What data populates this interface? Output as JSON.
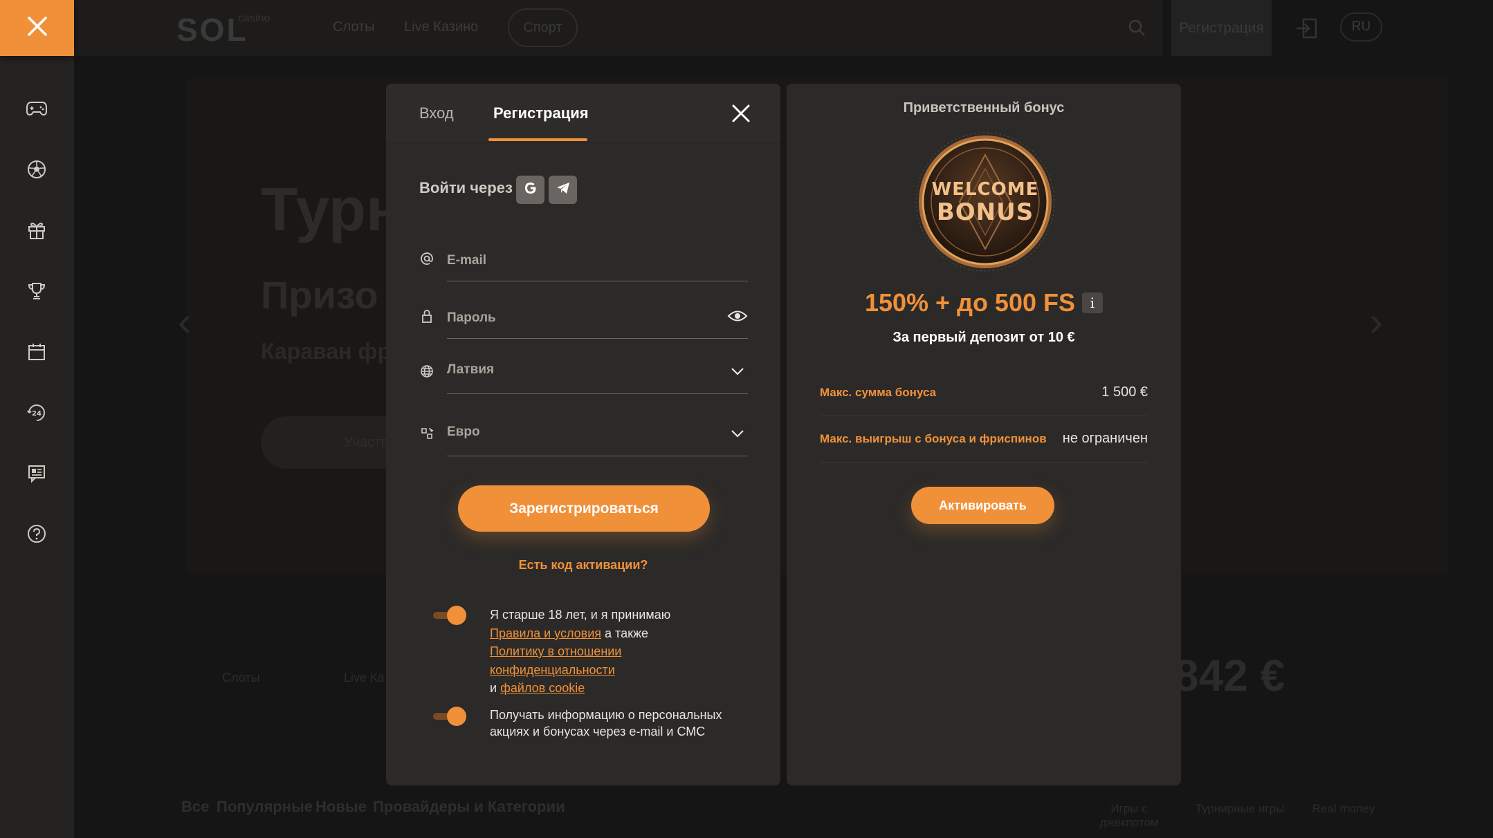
{
  "colors": {
    "accent": "#f0913a",
    "panel": "#2c2a28",
    "sidebar": "#252321"
  },
  "sidebar": {
    "items": [
      {
        "icon": "gamepad-icon"
      },
      {
        "icon": "soccer-ball-icon"
      },
      {
        "icon": "gift-icon"
      },
      {
        "icon": "trophy-icon"
      },
      {
        "icon": "calendar-icon"
      },
      {
        "icon": "support-24-icon"
      },
      {
        "icon": "news-icon"
      },
      {
        "icon": "help-icon"
      }
    ]
  },
  "background": {
    "logo": "SOL",
    "logo_sub": "casino",
    "nav": [
      "Слоты",
      "Live Казино",
      "Спорт"
    ],
    "register": "Регистрация",
    "lang": "RU",
    "banner_title": "Турн",
    "banner_subtitle": "Призо",
    "banner_text": "Караван фр",
    "banner_button": "Участв",
    "tiles": [
      "Слоты",
      "Live Ка"
    ],
    "amount": "842 €",
    "categories": [
      "Все",
      "Популярные",
      "Новые",
      "Провайдеры и Категории"
    ],
    "bottom_links": [
      "Игры с джекпотом",
      "Турнирные игры",
      "Real money"
    ]
  },
  "auth": {
    "tabs": {
      "login": "Вход",
      "register": "Регистрация"
    },
    "social_label": "Войти через",
    "fields": {
      "email_placeholder": "E-mail",
      "password_placeholder": "Пароль",
      "country": "Латвия",
      "currency": "Евро"
    },
    "register_button": "Зарегистрироваться",
    "activation_link": "Есть код активации?",
    "consent1": {
      "text1": "Я старше 18 лет, и я принимаю",
      "link_terms": "Правила и условия",
      "text2": "а также",
      "link_privacy": "Политику в отношении конфиденциальности",
      "text3": "и",
      "link_cookies": "файлов cookie"
    },
    "consent2": "Получать информацию о персональных акциях и бонусах через e-mail и СМС"
  },
  "bonus": {
    "title": "Приветственный бонус",
    "coin_line1": "WELCOME",
    "coin_line2": "BONUS",
    "amount": "150% + до 500 FS",
    "info_icon": "i",
    "subtitle": "За первый депозит от 10 €",
    "rows": [
      {
        "label": "Макс. сумма бонуса",
        "value": "1 500 €"
      },
      {
        "label": "Макс. выигрыш с бонуса и фриспинов",
        "value": "не ограничен"
      }
    ],
    "activate_button": "Активировать"
  }
}
